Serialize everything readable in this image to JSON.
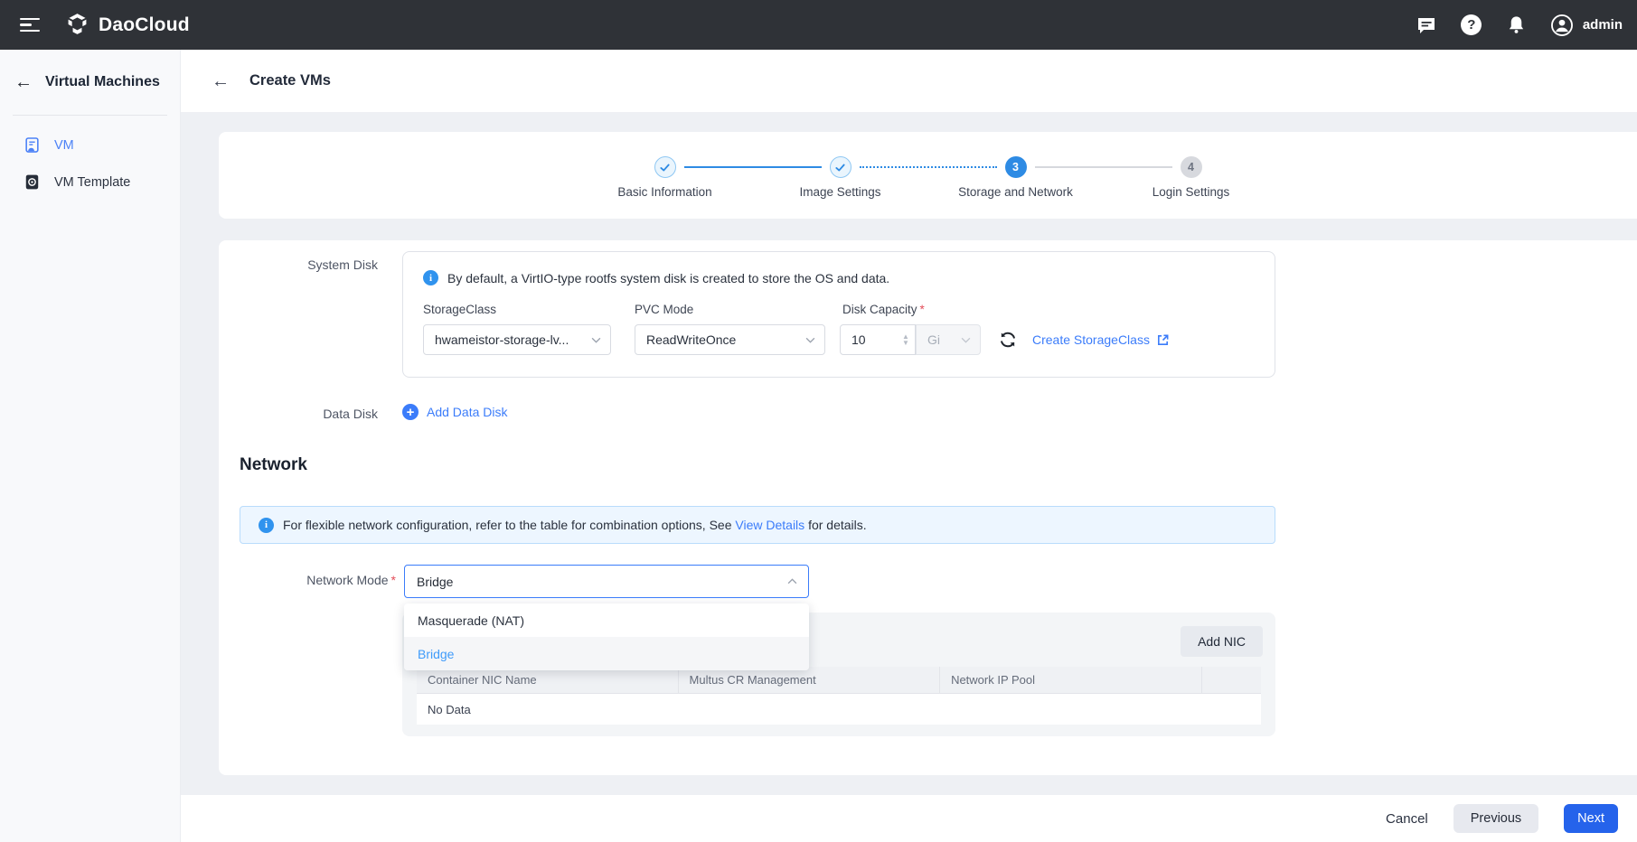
{
  "topbar": {
    "brand": "DaoCloud",
    "user": "admin"
  },
  "sidebar": {
    "title": "Virtual Machines",
    "items": [
      {
        "label": "VM"
      },
      {
        "label": "VM Template"
      }
    ]
  },
  "page_header": {
    "title": "Create VMs"
  },
  "stepper": {
    "steps": [
      {
        "label": "Basic Information",
        "state": "done"
      },
      {
        "label": "Image Settings",
        "state": "done"
      },
      {
        "label": "Storage and Network",
        "state": "current",
        "number": "3"
      },
      {
        "label": "Login Settings",
        "state": "todo",
        "number": "4"
      }
    ]
  },
  "system_disk": {
    "label": "System Disk",
    "info": "By default, a VirtIO-type rootfs system disk is created to store the OS and data.",
    "storage_class": {
      "label": "StorageClass",
      "value": "hwameistor-storage-lv..."
    },
    "pvc_mode": {
      "label": "PVC Mode",
      "value": "ReadWriteOnce"
    },
    "disk_capacity": {
      "label": "Disk Capacity",
      "value": "10",
      "unit": "Gi"
    },
    "create_link": "Create StorageClass"
  },
  "data_disk": {
    "label": "Data Disk",
    "add_link": "Add Data Disk"
  },
  "network": {
    "heading": "Network",
    "banner": {
      "text_before": "For flexible network configuration, refer to the table for combination options, See",
      "link": "View Details",
      "text_after": "for details."
    },
    "mode": {
      "label": "Network Mode",
      "value": "Bridge",
      "options": [
        "Masquerade (NAT)",
        "Bridge"
      ]
    },
    "nic": {
      "add_button": "Add NIC",
      "table": {
        "headers": [
          "Container NIC Name",
          "Multus CR Management",
          "Network IP Pool"
        ],
        "empty": "No Data"
      }
    }
  },
  "footer": {
    "cancel": "Cancel",
    "previous": "Previous",
    "next": "Next"
  },
  "ui": {
    "required_mark": "*"
  },
  "colors": {
    "accent": "#3b7cfa",
    "stepper_blue": "#2e8be4",
    "next_button": "#2563eb",
    "option_active": "#3f9bfa",
    "topbar_bg": "#2f3237"
  }
}
